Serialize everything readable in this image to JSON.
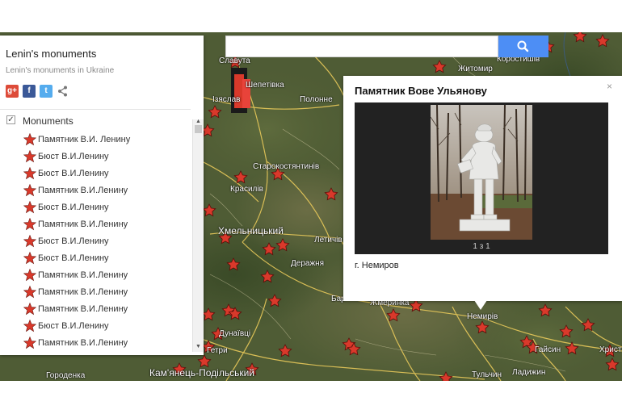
{
  "panel": {
    "title": "Lenin's monuments",
    "subtitle": "Lenin's monuments in Ukraine",
    "share_icons": [
      "google-plus-icon",
      "facebook-icon",
      "twitter-icon",
      "share-icon"
    ],
    "layer": {
      "name": "Monuments",
      "checked": true
    },
    "items": [
      "Памятник В.И. Ленину",
      "Бюст В.И.Ленину",
      "Бюст В.И.Ленину",
      "Памятник В.И.Ленину",
      "Бюст В.И.Ленину",
      "Памятник В.И.Ленину",
      "Бюст В.И.Ленину",
      "Бюст В.И.Ленину",
      "Памятник В.И.Ленину",
      "Памятник В.И.Ленину",
      "Памятник В.И.Ленину",
      "Бюст В.И.Ленину",
      "Памятник В.И.Ленину"
    ]
  },
  "search": {
    "placeholder": "",
    "button_icon": "search-icon"
  },
  "info": {
    "title": "Памятник Вове Ульянову",
    "counter": "1 з 1",
    "description": "г. Немиров",
    "close": "×"
  },
  "cities": [
    "Славута",
    "Шепетівка",
    "Ізяслав",
    "Полонне",
    "Старокостянтинів",
    "Красилів",
    "Хмельницький",
    "Летичів",
    "Деражня",
    "Житомир",
    "Коростишів",
    "Жмеринка",
    "Немирів",
    "Гайсин",
    "Тульчин",
    "Ладижин",
    "Кам'янець-Подільський",
    "Городенка",
    "Дунаївці",
    "Христ",
    "Бар",
    "Гетри"
  ],
  "colors": {
    "marker": "#d9392b",
    "map_base": "#4d5a33",
    "road": "#e8c95a",
    "search_button": "#4d8ef5"
  }
}
